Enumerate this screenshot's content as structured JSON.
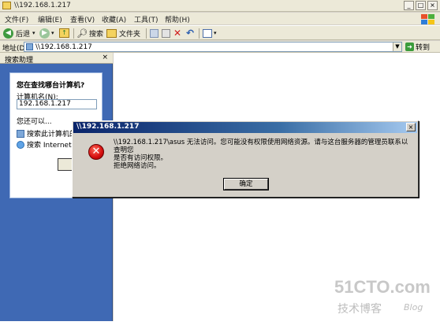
{
  "window": {
    "title": "\\\\192.168.1.217",
    "controls": {
      "minimize": "_",
      "maximize": "□",
      "close": "×"
    }
  },
  "menu": [
    "文件(F)",
    "编辑(E)",
    "查看(V)",
    "收藏(A)",
    "工具(T)",
    "帮助(H)"
  ],
  "toolbar": {
    "back_label": "后退",
    "search_label": "搜索",
    "folders_label": "文件夹"
  },
  "address": {
    "label": "地址(D)",
    "value": "\\\\192.168.1.217",
    "go_label": "转到"
  },
  "search_pane": {
    "title": "搜索助理",
    "close": "×",
    "question": "您在查找哪台计算机?",
    "field_label": "计算机名(N):",
    "field_value": "192.168.1.217",
    "also_label": "您还可以...",
    "link_computer": "搜索此计算机的",
    "link_internet": "搜索 Internet(I)",
    "button_label": "搜"
  },
  "dialog": {
    "title": "\\\\192.168.1.217",
    "close": "×",
    "message_line1": "\\\\192.168.1.217\\asus 无法访问。您可能没有权限使用网络资源。请与这台服务器的管理员联系以查明您",
    "message_line2": "是否有访问权限。",
    "message_detail": "拒绝网络访问。",
    "ok_label": "确定",
    "icon": "error-icon"
  },
  "watermark": {
    "logo": "51CTO.com",
    "sub": "技术博客",
    "blog": "Blog"
  }
}
